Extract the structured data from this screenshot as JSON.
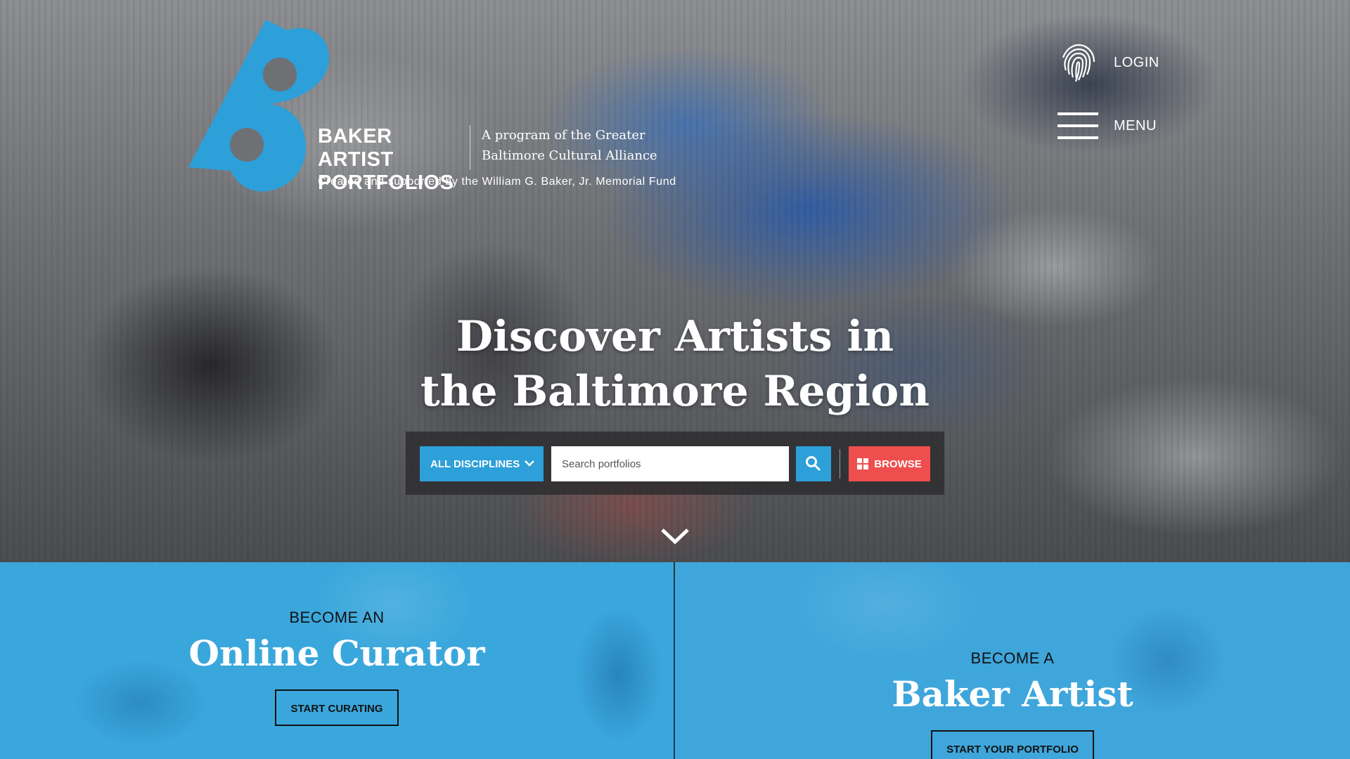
{
  "brand": {
    "name": "BAKER ARTIST PORTFOLIOS",
    "name_line1": "BAKER ARTIST",
    "name_line2": "PORTFOLIOS",
    "program_line1": "A program of the Greater",
    "program_line2": "Baltimore Cultural Alliance",
    "fund": "Created and supported by the William G. Baker, Jr. Memorial Fund",
    "accent": "#2d9fd9"
  },
  "nav": {
    "login_label": "LOGIN",
    "menu_label": "MENU",
    "login_icon": "fingerprint-icon",
    "menu_icon": "hamburger-icon"
  },
  "hero": {
    "headline_line1": "Discover Artists in",
    "headline_line2": "the Baltimore Region"
  },
  "search": {
    "discipline_label": "ALL DISCIPLINES",
    "placeholder": "Search portfolios",
    "value": "",
    "browse_label": "BROWSE",
    "search_color": "#2d9fd9",
    "browse_color": "#ef4e4e"
  },
  "panels": {
    "curator": {
      "pre": "BECOME AN",
      "title": "Online Curator",
      "button": "START CURATING"
    },
    "artist": {
      "pre": "BECOME A",
      "title": "Baker Artist",
      "button": "START YOUR PORTFOLIO"
    }
  }
}
